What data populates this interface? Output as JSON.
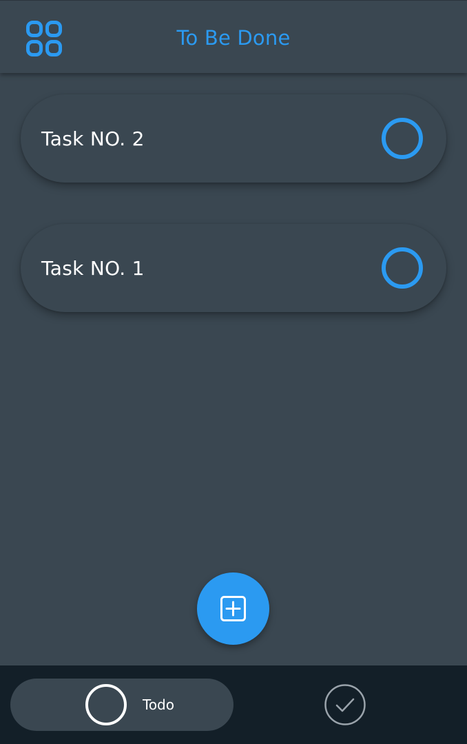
{
  "app_bar": {
    "title": "To Be Done",
    "menu_icon": "grid-four-icon"
  },
  "tasks": [
    {
      "label": "Task NO. 2",
      "done": false
    },
    {
      "label": "Task NO. 1",
      "done": false
    }
  ],
  "fab": {
    "icon": "plus-square-icon"
  },
  "bottom_nav": {
    "todo_label": "Todo",
    "todo_icon": "circle-outline-icon",
    "done_icon": "check-circle-icon"
  },
  "colors": {
    "accent": "#2b9af1",
    "background": "#3a4751",
    "nav_background": "#131f28",
    "text": "#ffffff",
    "inactive_icon": "#9aa3ab"
  }
}
